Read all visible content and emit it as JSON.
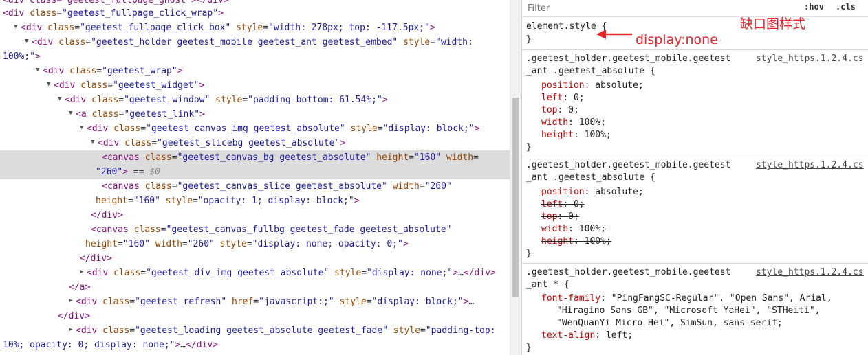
{
  "elements_tree": {
    "lines": [
      {
        "indent": 0,
        "arrow": "",
        "selected": false,
        "parts": [
          {
            "c": "tag",
            "t": "<div class=\"geetest_fullpage_ghost\"></div>"
          }
        ]
      },
      {
        "indent": 0,
        "arrow": "",
        "selected": false,
        "parts": [
          {
            "c": "tag",
            "t": "<div "
          },
          {
            "c": "an",
            "t": "class"
          },
          {
            "c": "eq",
            "t": "="
          },
          {
            "c": "av",
            "t": "\"geetest_fullpage_click_wrap\""
          },
          {
            "c": "tag",
            "t": ">"
          }
        ]
      },
      {
        "indent": 1,
        "arrow": "▼",
        "selected": false,
        "parts": [
          {
            "c": "tag",
            "t": "<div "
          },
          {
            "c": "an",
            "t": "class"
          },
          {
            "c": "eq",
            "t": "="
          },
          {
            "c": "av",
            "t": "\"geetest_fullpage_click_box\""
          },
          {
            "c": "tag",
            "t": " "
          },
          {
            "c": "an",
            "t": "style"
          },
          {
            "c": "eq",
            "t": "="
          },
          {
            "c": "av",
            "t": "\"width: 278px; top: -117.5px;\""
          },
          {
            "c": "tag",
            "t": ">"
          }
        ]
      },
      {
        "indent": 2,
        "arrow": "▼",
        "selected": false,
        "parts": [
          {
            "c": "tag",
            "t": "<div "
          },
          {
            "c": "an",
            "t": "class"
          },
          {
            "c": "eq",
            "t": "="
          },
          {
            "c": "av",
            "t": "\"geetest_holder geetest_mobile geetest_ant geetest_embed\""
          },
          {
            "c": "tag",
            "t": " "
          },
          {
            "c": "an",
            "t": "style"
          },
          {
            "c": "eq",
            "t": "="
          },
          {
            "c": "av",
            "t": "\"width:"
          }
        ]
      },
      {
        "indent": 0,
        "arrow": "",
        "selected": false,
        "parts": [
          {
            "c": "av",
            "t": "100%;\""
          },
          {
            "c": "tag",
            "t": ">"
          }
        ]
      },
      {
        "indent": 3,
        "arrow": "▼",
        "selected": false,
        "parts": [
          {
            "c": "tag",
            "t": "<div "
          },
          {
            "c": "an",
            "t": "class"
          },
          {
            "c": "eq",
            "t": "="
          },
          {
            "c": "av",
            "t": "\"geetest_wrap\""
          },
          {
            "c": "tag",
            "t": ">"
          }
        ]
      },
      {
        "indent": 4,
        "arrow": "▼",
        "selected": false,
        "parts": [
          {
            "c": "tag",
            "t": "<div "
          },
          {
            "c": "an",
            "t": "class"
          },
          {
            "c": "eq",
            "t": "="
          },
          {
            "c": "av",
            "t": "\"geetest_widget\""
          },
          {
            "c": "tag",
            "t": ">"
          }
        ]
      },
      {
        "indent": 5,
        "arrow": "▼",
        "selected": false,
        "parts": [
          {
            "c": "tag",
            "t": "<div "
          },
          {
            "c": "an",
            "t": "class"
          },
          {
            "c": "eq",
            "t": "="
          },
          {
            "c": "av",
            "t": "\"geetest_window\""
          },
          {
            "c": "tag",
            "t": " "
          },
          {
            "c": "an",
            "t": "style"
          },
          {
            "c": "eq",
            "t": "="
          },
          {
            "c": "av",
            "t": "\"padding-bottom: 61.54%;\""
          },
          {
            "c": "tag",
            "t": ">"
          }
        ]
      },
      {
        "indent": 6,
        "arrow": "▼",
        "selected": false,
        "parts": [
          {
            "c": "tag",
            "t": "<a "
          },
          {
            "c": "an",
            "t": "class"
          },
          {
            "c": "eq",
            "t": "="
          },
          {
            "c": "av",
            "t": "\"geetest_link\""
          },
          {
            "c": "tag",
            "t": ">"
          }
        ]
      },
      {
        "indent": 7,
        "arrow": "▼",
        "selected": false,
        "parts": [
          {
            "c": "tag",
            "t": "<div "
          },
          {
            "c": "an",
            "t": "class"
          },
          {
            "c": "eq",
            "t": "="
          },
          {
            "c": "av",
            "t": "\"geetest_canvas_img geetest_absolute\""
          },
          {
            "c": "tag",
            "t": " "
          },
          {
            "c": "an",
            "t": "style"
          },
          {
            "c": "eq",
            "t": "="
          },
          {
            "c": "av",
            "t": "\"display: block;\""
          },
          {
            "c": "tag",
            "t": ">"
          }
        ]
      },
      {
        "indent": 8,
        "arrow": "▼",
        "selected": false,
        "parts": [
          {
            "c": "tag",
            "t": "<div "
          },
          {
            "c": "an",
            "t": "class"
          },
          {
            "c": "eq",
            "t": "="
          },
          {
            "c": "av",
            "t": "\"geetest_slicebg geetest_absolute\""
          },
          {
            "c": "tag",
            "t": ">"
          }
        ]
      },
      {
        "indent": 9,
        "arrow": "",
        "selected": true,
        "parts": [
          {
            "c": "tag",
            "t": "<canvas "
          },
          {
            "c": "an",
            "t": "class"
          },
          {
            "c": "eq",
            "t": "="
          },
          {
            "c": "av",
            "t": "\"geetest_canvas_bg geetest_absolute\""
          },
          {
            "c": "tag",
            "t": " "
          },
          {
            "c": "an",
            "t": "height"
          },
          {
            "c": "eq",
            "t": "="
          },
          {
            "c": "av",
            "t": "\"160\""
          },
          {
            "c": "tag",
            "t": " "
          },
          {
            "c": "an",
            "t": "width"
          },
          {
            "c": "eq",
            "t": "="
          }
        ]
      },
      {
        "indent": 9,
        "arrow": "",
        "selected": true,
        "parts": [
          {
            "c": "av",
            "t": "\"260\""
          },
          {
            "c": "tag",
            "t": ">"
          },
          {
            "c": "marker",
            "t": " == "
          },
          {
            "c": "marker-i",
            "t": "$0"
          }
        ]
      },
      {
        "indent": 9,
        "arrow": "",
        "selected": false,
        "parts": [
          {
            "c": "tag",
            "t": "<canvas "
          },
          {
            "c": "an",
            "t": "class"
          },
          {
            "c": "eq",
            "t": "="
          },
          {
            "c": "av",
            "t": "\"geetest_canvas_slice geetest_absolute\""
          },
          {
            "c": "tag",
            "t": " "
          },
          {
            "c": "an",
            "t": "width"
          },
          {
            "c": "eq",
            "t": "="
          },
          {
            "c": "av",
            "t": "\"260\""
          }
        ]
      },
      {
        "indent": 9,
        "arrow": "",
        "selected": false,
        "parts": [
          {
            "c": "an",
            "t": "height"
          },
          {
            "c": "eq",
            "t": "="
          },
          {
            "c": "av",
            "t": "\"160\""
          },
          {
            "c": "tag",
            "t": " "
          },
          {
            "c": "an",
            "t": "style"
          },
          {
            "c": "eq",
            "t": "="
          },
          {
            "c": "av",
            "t": "\"opacity: 1; display: block;\""
          },
          {
            "c": "tag",
            "t": ">"
          }
        ]
      },
      {
        "indent": 8,
        "arrow": "",
        "selected": false,
        "parts": [
          {
            "c": "tag",
            "t": "</div>"
          }
        ]
      },
      {
        "indent": 8,
        "arrow": "",
        "selected": false,
        "parts": [
          {
            "c": "tag",
            "t": "<canvas "
          },
          {
            "c": "an",
            "t": "class"
          },
          {
            "c": "eq",
            "t": "="
          },
          {
            "c": "av",
            "t": "\"geetest_canvas_fullbg geetest_fade geetest_absolute\""
          }
        ]
      },
      {
        "indent": 8,
        "arrow": "",
        "selected": false,
        "parts": [
          {
            "c": "an",
            "t": "height"
          },
          {
            "c": "eq",
            "t": "="
          },
          {
            "c": "av",
            "t": "\"160\""
          },
          {
            "c": "tag",
            "t": " "
          },
          {
            "c": "an",
            "t": "width"
          },
          {
            "c": "eq",
            "t": "="
          },
          {
            "c": "av",
            "t": "\"260\""
          },
          {
            "c": "tag",
            "t": " "
          },
          {
            "c": "an",
            "t": "style"
          },
          {
            "c": "eq",
            "t": "="
          },
          {
            "c": "av",
            "t": "\"display: none; opacity: 0;\""
          },
          {
            "c": "tag",
            "t": ">"
          }
        ]
      },
      {
        "indent": 7,
        "arrow": "",
        "selected": false,
        "parts": [
          {
            "c": "tag",
            "t": "</div>"
          }
        ]
      },
      {
        "indent": 7,
        "arrow": "▶",
        "selected": false,
        "parts": [
          {
            "c": "tag",
            "t": "<div "
          },
          {
            "c": "an",
            "t": "class"
          },
          {
            "c": "eq",
            "t": "="
          },
          {
            "c": "av",
            "t": "\"geetest_div_img geetest_absolute\""
          },
          {
            "c": "tag",
            "t": " "
          },
          {
            "c": "an",
            "t": "style"
          },
          {
            "c": "eq",
            "t": "="
          },
          {
            "c": "av",
            "t": "\"display: none;\""
          },
          {
            "c": "tag",
            "t": ">"
          },
          {
            "c": "dots",
            "t": "…"
          },
          {
            "c": "tag",
            "t": "</div>"
          }
        ]
      },
      {
        "indent": 6,
        "arrow": "",
        "selected": false,
        "parts": [
          {
            "c": "tag",
            "t": "</a>"
          }
        ]
      },
      {
        "indent": 6,
        "arrow": "▶",
        "selected": false,
        "parts": [
          {
            "c": "tag",
            "t": "<div "
          },
          {
            "c": "an",
            "t": "class"
          },
          {
            "c": "eq",
            "t": "="
          },
          {
            "c": "av",
            "t": "\"geetest_refresh\""
          },
          {
            "c": "tag",
            "t": " "
          },
          {
            "c": "an",
            "t": "href"
          },
          {
            "c": "eq",
            "t": "="
          },
          {
            "c": "av",
            "t": "\"javascript:;\""
          },
          {
            "c": "tag",
            "t": " "
          },
          {
            "c": "an",
            "t": "style"
          },
          {
            "c": "eq",
            "t": "="
          },
          {
            "c": "av",
            "t": "\"display: block;\""
          },
          {
            "c": "tag",
            "t": ">"
          },
          {
            "c": "dots",
            "t": "…"
          }
        ]
      },
      {
        "indent": 5,
        "arrow": "",
        "selected": false,
        "parts": [
          {
            "c": "tag",
            "t": "</div>"
          }
        ]
      },
      {
        "indent": 6,
        "arrow": "▶",
        "selected": false,
        "parts": [
          {
            "c": "tag",
            "t": "<div "
          },
          {
            "c": "an",
            "t": "class"
          },
          {
            "c": "eq",
            "t": "="
          },
          {
            "c": "av",
            "t": "\"geetest_loading geetest_absolute geetest_fade\""
          },
          {
            "c": "tag",
            "t": " "
          },
          {
            "c": "an",
            "t": "style"
          },
          {
            "c": "eq",
            "t": "="
          },
          {
            "c": "av",
            "t": "\"padding-top:"
          }
        ]
      },
      {
        "indent": 0,
        "arrow": "",
        "selected": false,
        "parts": [
          {
            "c": "av",
            "t": "10%; opacity: 0; display: none;\""
          },
          {
            "c": "tag",
            "t": ">"
          },
          {
            "c": "dots",
            "t": "…"
          },
          {
            "c": "tag",
            "t": "</div>"
          }
        ]
      }
    ]
  },
  "styles_pane": {
    "filter_placeholder": "Filter",
    "hov_label": ":hov",
    "cls_label": ".cls",
    "element_style_open": "element.style {",
    "element_style_close": "}",
    "annotation_missing_style": "缺口图样式",
    "annotation_display_none": "display:none",
    "rules": [
      {
        "selector_line1": ".geetest_holder.geetest_mobile.geetest",
        "selector_line2": "_ant .geetest_absolute {",
        "source": "style_https.1.2.4.cs",
        "struck": false,
        "props": [
          {
            "name": "position",
            "value": "absolute;"
          },
          {
            "name": "left",
            "value": "0;"
          },
          {
            "name": "top",
            "value": "0;"
          },
          {
            "name": "width",
            "value": "100%;"
          },
          {
            "name": "height",
            "value": "100%;"
          }
        ],
        "close": "}"
      },
      {
        "selector_line1": ".geetest_holder.geetest_mobile.geetest",
        "selector_line2": "_ant .geetest_absolute {",
        "source": "style_https.1.2.4.cs",
        "struck": true,
        "props": [
          {
            "name": "position",
            "value": "absolute;"
          },
          {
            "name": "left",
            "value": "0;"
          },
          {
            "name": "top",
            "value": "0;"
          },
          {
            "name": "width",
            "value": "100%;"
          },
          {
            "name": "height",
            "value": "100%;"
          }
        ],
        "close": "}"
      },
      {
        "selector_line1": ".geetest_holder.geetest_mobile.geetest",
        "selector_line2": "_ant * {",
        "source": "style_https.1.2.4.cs",
        "struck": false,
        "font_family_name": "font-family",
        "font_family_lines": [
          "\"PingFangSC-Regular\", \"Open Sans\", Arial,",
          "\"Hiragino Sans GB\", \"Microsoft YaHei\", \"STHeiti\",",
          "\"WenQuanYi Micro Hei\", SimSun, sans-serif;"
        ],
        "text_align_name": "text-align",
        "text_align_value": "left;",
        "close": "}"
      }
    ]
  },
  "colors": {
    "annotation_red": "#e8232a",
    "selected_row": "#dcdcdc",
    "prop_name": "#c80000"
  }
}
